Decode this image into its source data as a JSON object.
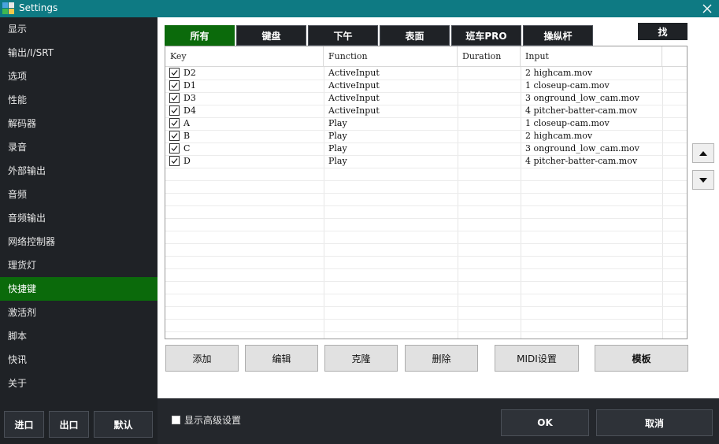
{
  "window": {
    "title": "Settings"
  },
  "sidebar": {
    "items": [
      {
        "label": "显示"
      },
      {
        "label": "输出/I/SRT"
      },
      {
        "label": "选项"
      },
      {
        "label": "性能"
      },
      {
        "label": "解码器"
      },
      {
        "label": "录音"
      },
      {
        "label": "外部输出"
      },
      {
        "label": "音频"
      },
      {
        "label": "音频输出"
      },
      {
        "label": "网络控制器"
      },
      {
        "label": "理货灯"
      },
      {
        "label": "快捷键",
        "active": true
      },
      {
        "label": "激活剂"
      },
      {
        "label": "脚本"
      },
      {
        "label": "快讯"
      },
      {
        "label": "关于"
      }
    ],
    "buttons": {
      "import": "进口",
      "export": "出口",
      "default": "默认"
    }
  },
  "tabs": [
    {
      "label": "所有",
      "active": true
    },
    {
      "label": "键盘"
    },
    {
      "label": "下午"
    },
    {
      "label": "表面"
    },
    {
      "label": "班车PRO"
    },
    {
      "label": "操纵杆"
    }
  ],
  "find_label": "找",
  "table": {
    "columns": [
      "Key",
      "Function",
      "Duration",
      "Input"
    ],
    "rows": [
      {
        "checked": true,
        "key": "D2",
        "function": "ActiveInput",
        "duration": "",
        "input": "2 highcam.mov"
      },
      {
        "checked": true,
        "key": "D1",
        "function": "ActiveInput",
        "duration": "",
        "input": "1 closeup-cam.mov"
      },
      {
        "checked": true,
        "key": "D3",
        "function": "ActiveInput",
        "duration": "",
        "input": "3 onground_low_cam.mov"
      },
      {
        "checked": true,
        "key": "D4",
        "function": "ActiveInput",
        "duration": "",
        "input": "4 pitcher-batter-cam.mov"
      },
      {
        "checked": true,
        "key": "A",
        "function": "Play",
        "duration": "",
        "input": "1 closeup-cam.mov"
      },
      {
        "checked": true,
        "key": "B",
        "function": "Play",
        "duration": "",
        "input": "2 highcam.mov"
      },
      {
        "checked": true,
        "key": "C",
        "function": "Play",
        "duration": "",
        "input": "3 onground_low_cam.mov"
      },
      {
        "checked": true,
        "key": "D",
        "function": "Play",
        "duration": "",
        "input": "4 pitcher-batter-cam.mov"
      }
    ]
  },
  "actions": {
    "add": "添加",
    "edit": "编辑",
    "clone": "克隆",
    "delete": "删除",
    "midi": "MIDI设置",
    "template": "模板"
  },
  "footer": {
    "advanced_label": "显示高级设置",
    "advanced_checked": false,
    "ok": "OK",
    "cancel": "取消"
  },
  "colors": {
    "titlebar": "#0e7a83",
    "sidebar_bg": "#1f2226",
    "accent_green": "#0b6a0b",
    "footer_bg": "#24272c"
  },
  "icons": [
    "app-icon",
    "close-icon",
    "check-icon",
    "arrow-up-icon",
    "arrow-down-icon"
  ]
}
